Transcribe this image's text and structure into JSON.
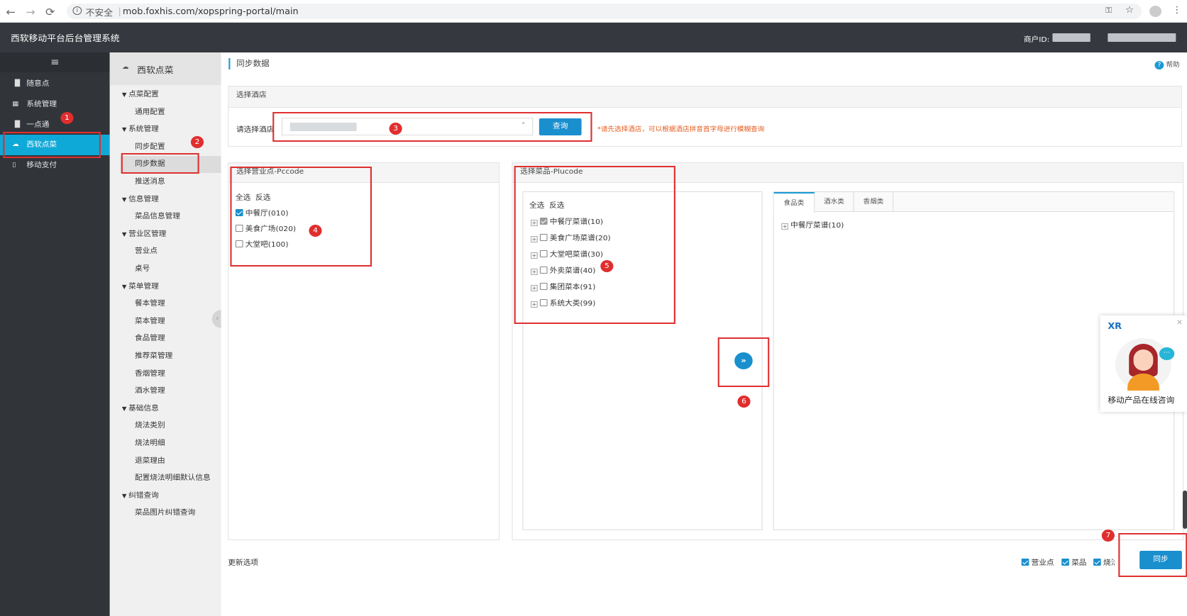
{
  "browser": {
    "back": "←",
    "forward": "→",
    "reload": "⟳",
    "security": "不安全",
    "url": "mob.foxhis.com/xopspring-portal/main"
  },
  "header": {
    "title": "西软移动平台后台管理系统",
    "merchant_label": "商户ID:"
  },
  "sidebar": {
    "items": [
      {
        "label": "随意点",
        "icon": "chart-bar-icon"
      },
      {
        "label": "系统管理",
        "icon": "grid-icon"
      },
      {
        "label": "一点通",
        "icon": "chart-bar-icon"
      },
      {
        "label": "西软点菜",
        "icon": "cloud-icon",
        "active": true
      },
      {
        "label": "移动支付",
        "icon": "phone-icon"
      }
    ]
  },
  "subnav": {
    "title": "西软点菜",
    "tree": [
      {
        "type": "grp",
        "label": "点菜配置"
      },
      {
        "type": "leaf",
        "label": "通用配置"
      },
      {
        "type": "grp",
        "label": "系统管理"
      },
      {
        "type": "leaf",
        "label": "同步配置"
      },
      {
        "type": "sel",
        "label": "同步数据"
      },
      {
        "type": "leaf",
        "label": "推送消息"
      },
      {
        "type": "grp",
        "label": "信息管理"
      },
      {
        "type": "leaf",
        "label": "菜品信息管理"
      },
      {
        "type": "grp",
        "label": "营业区管理"
      },
      {
        "type": "leaf",
        "label": "营业点"
      },
      {
        "type": "leaf",
        "label": "桌号"
      },
      {
        "type": "grp",
        "label": "菜单管理"
      },
      {
        "type": "leaf",
        "label": "餐本管理"
      },
      {
        "type": "leaf",
        "label": "菜本管理"
      },
      {
        "type": "leaf",
        "label": "食品管理"
      },
      {
        "type": "leaf",
        "label": "推荐菜管理"
      },
      {
        "type": "leaf",
        "label": "香烟管理"
      },
      {
        "type": "leaf",
        "label": "酒水管理"
      },
      {
        "type": "grp",
        "label": "基础信息"
      },
      {
        "type": "leaf",
        "label": "烧法类别"
      },
      {
        "type": "leaf",
        "label": "烧法明细"
      },
      {
        "type": "leaf",
        "label": "退菜理由"
      },
      {
        "type": "leaf",
        "label": "配置烧法明细默认信息"
      },
      {
        "type": "grp",
        "label": "纠错查询"
      },
      {
        "type": "leaf",
        "label": "菜品图片纠错查询"
      }
    ]
  },
  "main": {
    "page_title": "同步数据",
    "help": "帮助",
    "hotel_panel": {
      "title": "选择酒店",
      "label": "请选择酒店",
      "query_button": "查询",
      "hint": "*请先选择酒店，可以根据酒店拼音首字母进行模糊查询"
    },
    "pccode_panel": {
      "title": "选择营业点-Pccode",
      "select_all": "全选",
      "invert": "反选",
      "items": [
        {
          "label": "中餐厅(010)",
          "checked": true
        },
        {
          "label": "美食广场(020)",
          "checked": false
        },
        {
          "label": "大堂吧(100)",
          "checked": false
        }
      ]
    },
    "plucode_panel": {
      "title": "选择菜品-Plucode",
      "select_all": "全选",
      "invert": "反选",
      "items": [
        {
          "label": "中餐厅菜谱(10)",
          "checked": true
        },
        {
          "label": "美食广场菜谱(20)",
          "checked": false
        },
        {
          "label": "大堂吧菜谱(30)",
          "checked": false
        },
        {
          "label": "外卖菜谱(40)",
          "checked": false
        },
        {
          "label": "集团菜本(91)",
          "checked": false
        },
        {
          "label": "系统大类(99)",
          "checked": false
        }
      ],
      "tabs": [
        "食品类",
        "酒水类",
        "香烟类"
      ],
      "tab_tree": [
        "中餐厅菜谱(10)"
      ]
    },
    "move_button": "»",
    "update_options": {
      "label": "更新选项",
      "options": [
        "营业点",
        "菜品",
        "烧法"
      ],
      "sync_button": "同步"
    }
  },
  "annotations": [
    "1",
    "2",
    "3",
    "4",
    "5",
    "6",
    "7"
  ],
  "chat_widget": {
    "logo": "XR",
    "close": "✕",
    "text": "移动产品在线咨询"
  },
  "colors": {
    "accent": "#1a8fce",
    "sidebar_active": "#0fa9d8",
    "annotation": "#e02e2e"
  }
}
